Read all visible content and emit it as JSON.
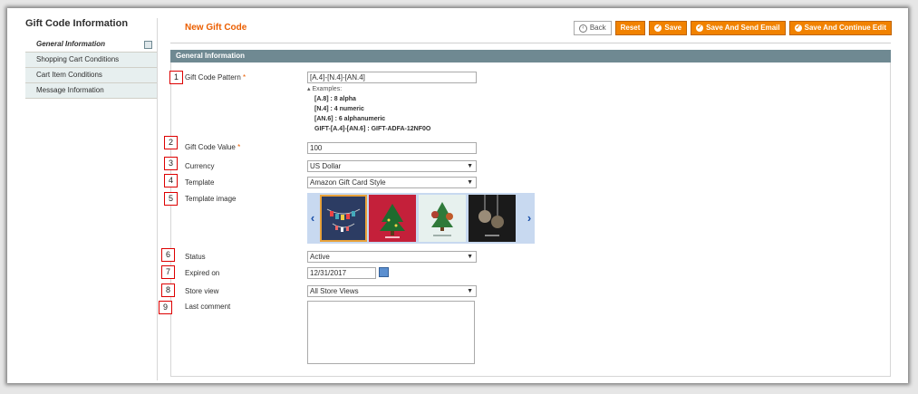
{
  "sidebar": {
    "title": "Gift Code Information",
    "tabs": [
      "General Information",
      "Shopping Cart Conditions",
      "Cart Item Conditions",
      "Message Information"
    ]
  },
  "header": {
    "title": "New Gift Code",
    "buttons": {
      "back": "Back",
      "reset": "Reset",
      "save": "Save",
      "save_send_email": "Save And Send Email",
      "save_continue": "Save And Continue Edit"
    }
  },
  "section": {
    "title": "General Information"
  },
  "markers": [
    "1",
    "2",
    "3",
    "4",
    "5",
    "6",
    "7",
    "8",
    "9"
  ],
  "form": {
    "pattern": {
      "label": "Gift Code Pattern",
      "value": "[A.4]-[N.4]-[AN.4]"
    },
    "examples": {
      "heading": "Examples:",
      "rows": [
        {
          "code": "[A.8]",
          "desc": " : 8 alpha"
        },
        {
          "code": "[N.4]",
          "desc": " : 4 numeric"
        },
        {
          "code": "[AN.6]",
          "desc": " : 6 alphanumeric"
        },
        {
          "code": "GIFT-[A.4]-[AN.6]",
          "desc": " : GIFT-ADFA-12NF0O"
        }
      ]
    },
    "value": {
      "label": "Gift Code Value",
      "value": "100"
    },
    "currency": {
      "label": "Currency",
      "value": "US Dollar"
    },
    "template": {
      "label": "Template",
      "value": "Amazon Gift Card Style"
    },
    "template_image": {
      "label": "Template image"
    },
    "status": {
      "label": "Status",
      "value": "Active"
    },
    "expired_on": {
      "label": "Expired on",
      "value": "12/31/2017"
    },
    "store_view": {
      "label": "Store view",
      "value": "All Store Views"
    },
    "last_comment": {
      "label": "Last comment"
    }
  },
  "colors": {
    "accent": "#f18200",
    "title": "#eb5e00",
    "section": "#6f8992"
  }
}
